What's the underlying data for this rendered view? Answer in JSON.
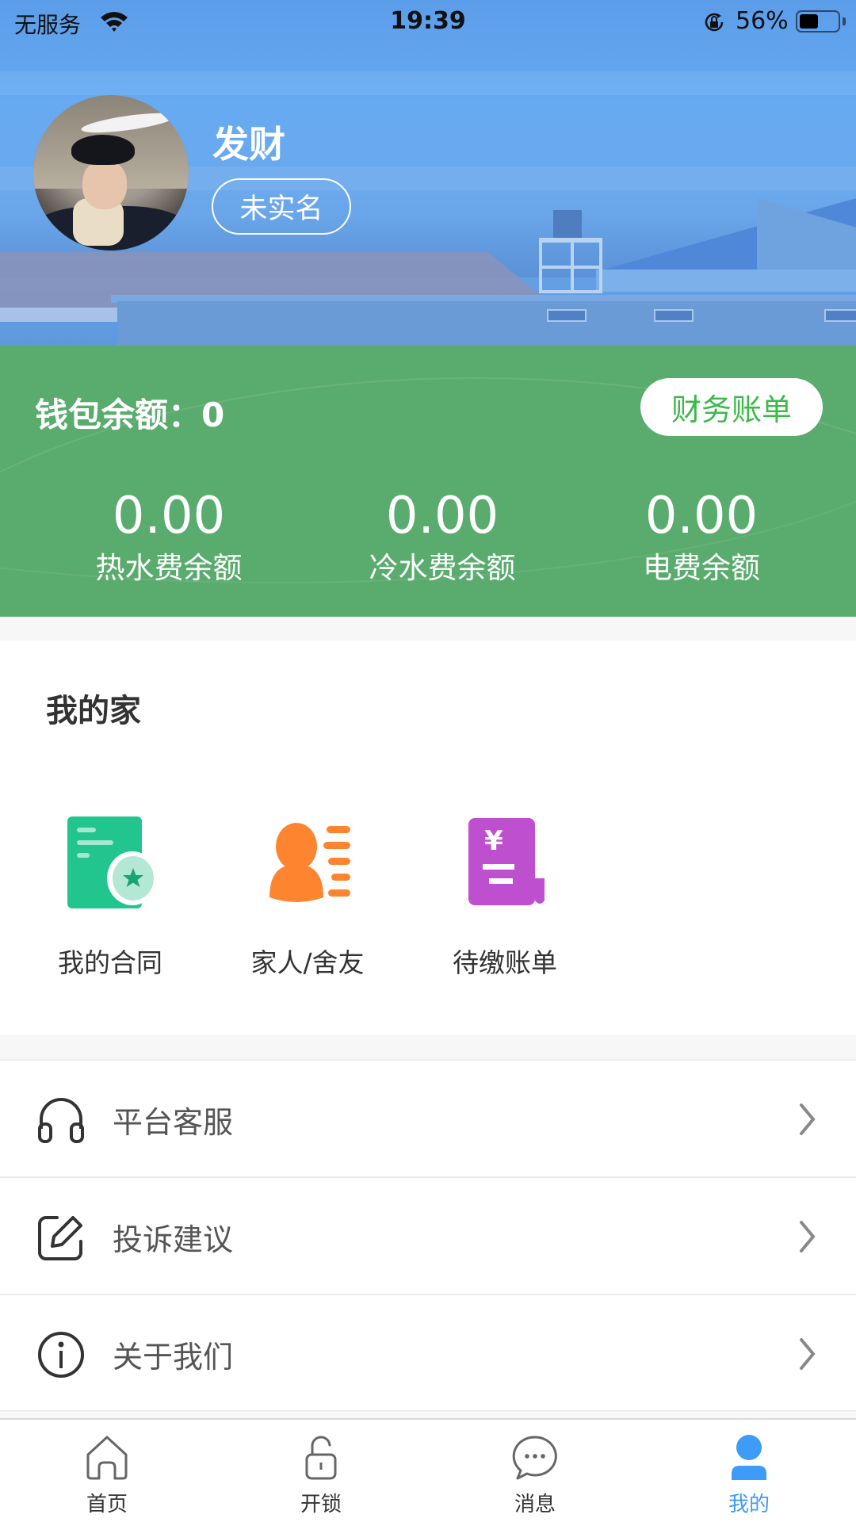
{
  "status_bar": {
    "carrier": "无服务",
    "time": "19:39",
    "battery_percent": "56%",
    "battery_level": 0.56
  },
  "profile": {
    "name": "发财",
    "verify_status": "未实名"
  },
  "wallet": {
    "balance_label": "钱包余额：0",
    "bill_button": "财务账单",
    "stats": [
      {
        "value": "0.00",
        "label": "热水费余额"
      },
      {
        "value": "0.00",
        "label": "冷水费余额"
      },
      {
        "value": "0.00",
        "label": "电费余额"
      }
    ],
    "colors": {
      "background": "#5aab6e",
      "button_text": "#3db84a"
    }
  },
  "my_home": {
    "title": "我的家",
    "items": [
      {
        "label": "我的合同",
        "icon": "contract-icon",
        "color": "#22c58e"
      },
      {
        "label": "家人/舍友",
        "icon": "family-contacts-icon",
        "color": "#fd8530"
      },
      {
        "label": "待缴账单",
        "icon": "pending-bill-icon",
        "color": "#be4fcf"
      }
    ]
  },
  "menu": {
    "items": [
      {
        "label": "平台客服",
        "icon": "headphones-icon"
      },
      {
        "label": "投诉建议",
        "icon": "edit-icon"
      },
      {
        "label": "关于我们",
        "icon": "info-icon"
      }
    ]
  },
  "tabbar": {
    "active_color": "#3e9bf7",
    "tabs": [
      {
        "label": "首页",
        "icon": "home-icon",
        "active": false
      },
      {
        "label": "开锁",
        "icon": "unlock-icon",
        "active": false
      },
      {
        "label": "消息",
        "icon": "message-icon",
        "active": false
      },
      {
        "label": "我的",
        "icon": "user-icon",
        "active": true
      }
    ]
  }
}
